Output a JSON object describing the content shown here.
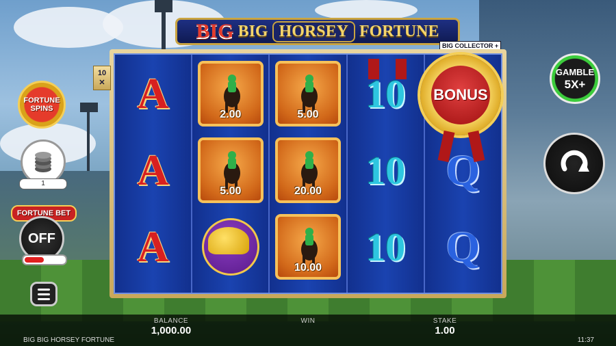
{
  "title": {
    "big1": "BIG",
    "big2": "BIG",
    "horsey": "HORSEY",
    "fortune": "FORTUNE",
    "collector": "BIG COLLECTOR +"
  },
  "ways_badge": {
    "top": "10",
    "bottom": "✕"
  },
  "reels": [
    {
      "cells": [
        {
          "type": "letter",
          "text": "A"
        },
        {
          "type": "letter",
          "text": "A"
        },
        {
          "type": "letter",
          "text": "A"
        }
      ]
    },
    {
      "cells": [
        {
          "type": "horse",
          "value": "2.00"
        },
        {
          "type": "horse",
          "value": "5.00"
        },
        {
          "type": "helmet"
        }
      ]
    },
    {
      "cells": [
        {
          "type": "horse",
          "value": "5.00"
        },
        {
          "type": "horse",
          "value": "20.00"
        },
        {
          "type": "horse",
          "value": "10.00"
        }
      ]
    },
    {
      "cells": [
        {
          "type": "ten",
          "text": "10"
        },
        {
          "type": "ten",
          "text": "10"
        },
        {
          "type": "ten",
          "text": "10"
        }
      ]
    },
    {
      "cells": [
        {
          "type": "bonus",
          "text": "BONUS"
        },
        {
          "type": "q",
          "text": "Q"
        },
        {
          "type": "q",
          "text": "Q"
        }
      ]
    }
  ],
  "left_controls": {
    "fortune_spins": {
      "line1": "FORTUNE",
      "line2": "SPINS"
    },
    "coins_value": "1",
    "fortune_bet_label": "FORTUNE BET",
    "fortune_bet_state": "OFF"
  },
  "right_controls": {
    "gamble_line1": "GAMBLE",
    "gamble_line2": "5X+"
  },
  "bottom_bar": {
    "balance_label": "BALANCE",
    "balance_value": "1,000.00",
    "win_label": "WIN",
    "win_value": "",
    "stake_label": "STAKE",
    "stake_value": "1.00",
    "game_name": "BIG BIG HORSEY FORTUNE",
    "clock": "11:37"
  },
  "colors": {
    "reel_bg": "#0e2a8a",
    "frame_gold": "#c9a85a",
    "letter_red": "#d82020",
    "q_blue": "#2a62e0",
    "ten_cyan": "#2ec6e0"
  }
}
